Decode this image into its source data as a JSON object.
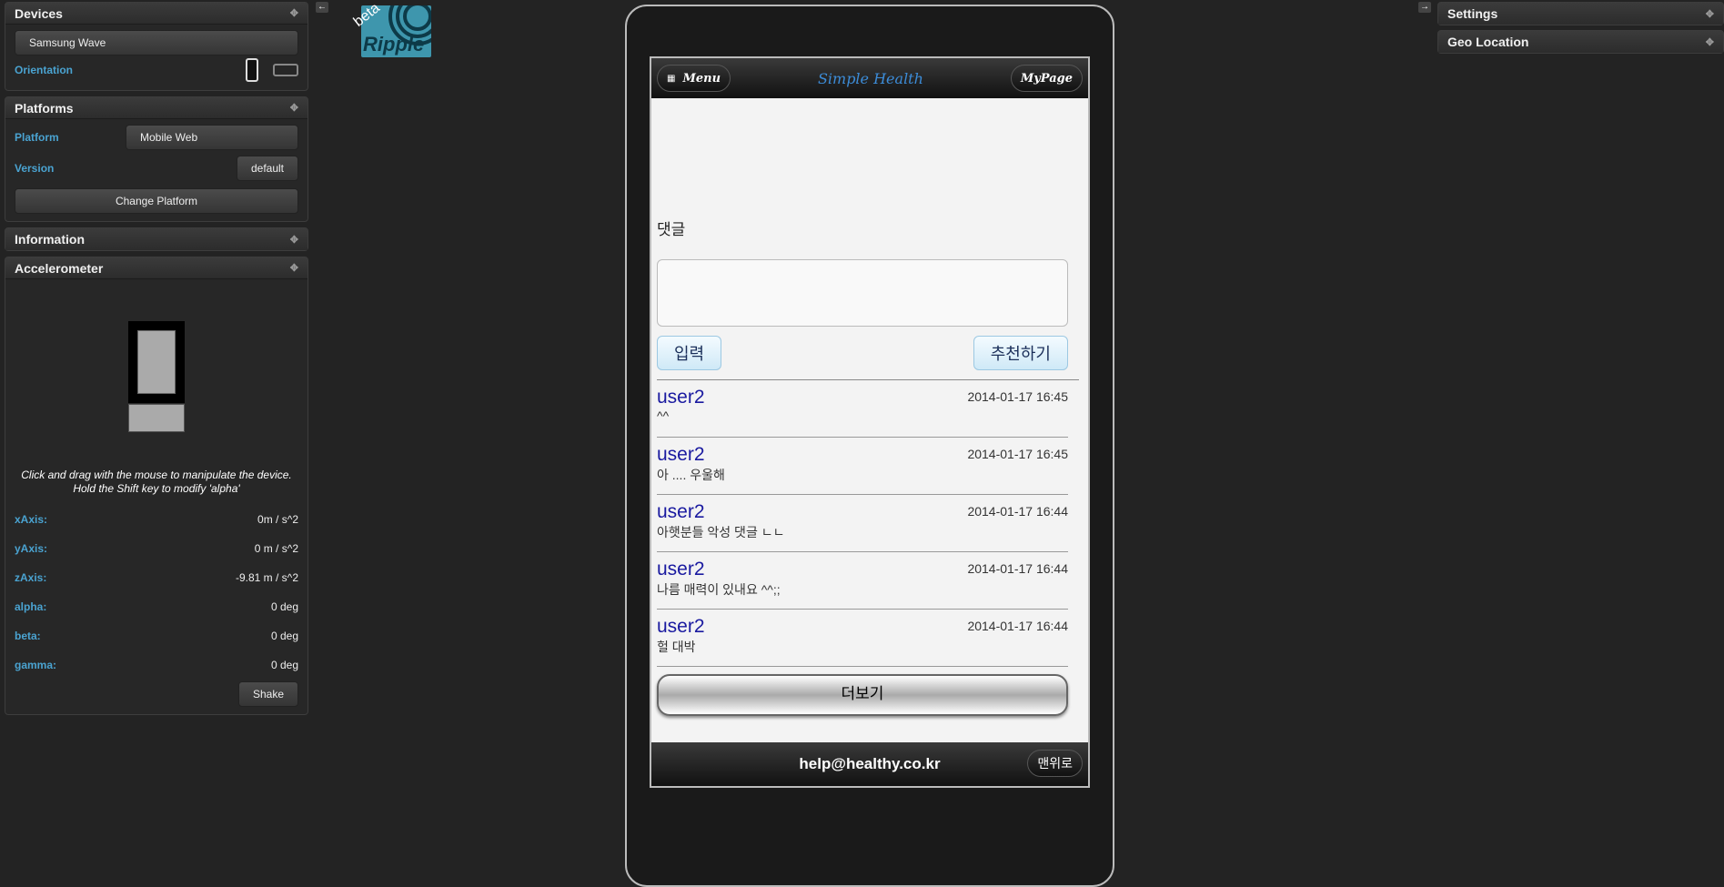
{
  "left": {
    "devices": {
      "title": "Devices",
      "device": "Samsung Wave",
      "orientation_label": "Orientation"
    },
    "platforms": {
      "title": "Platforms",
      "platform_label": "Platform",
      "platform_value": "Mobile Web",
      "version_label": "Version",
      "version_value": "default",
      "change_button": "Change Platform"
    },
    "information": {
      "title": "Information"
    },
    "accelerometer": {
      "title": "Accelerometer",
      "hint_line1": "Click and drag with the mouse to manipulate the device.",
      "hint_line2": "Hold the Shift key to modify 'alpha'",
      "rows": [
        {
          "label": "xAxis:",
          "value": "0m / s^2"
        },
        {
          "label": "yAxis:",
          "value": "0 m / s^2"
        },
        {
          "label": "zAxis:",
          "value": "-9.81 m / s^2"
        },
        {
          "label": "alpha:",
          "value": "0 deg"
        },
        {
          "label": "beta:",
          "value": "0 deg"
        },
        {
          "label": "gamma:",
          "value": "0 deg"
        }
      ],
      "shake_button": "Shake"
    }
  },
  "logo": {
    "text": "Ripple",
    "badge": "beta"
  },
  "app": {
    "menu_button": "Menu",
    "title": "Simple Health",
    "mypage_button": "MyPage",
    "comment_label": "댓글",
    "submit_button": "입력",
    "recommend_button": "추천하기",
    "comments": [
      {
        "user": "user2",
        "text": "^^",
        "date": "2014-01-17 16:45"
      },
      {
        "user": "user2",
        "text": "아 .... 우울해",
        "date": "2014-01-17 16:45"
      },
      {
        "user": "user2",
        "text": "아햇분들 악성 댓글 ㄴㄴ",
        "date": "2014-01-17 16:44"
      },
      {
        "user": "user2",
        "text": "나름 매력이 있내요 ^^;;",
        "date": "2014-01-17 16:44"
      },
      {
        "user": "user2",
        "text": "헐 대박",
        "date": "2014-01-17 16:44"
      }
    ],
    "more_button": "더보기",
    "footer_email": "help@healthy.co.kr",
    "top_button": "맨위로"
  },
  "right": {
    "settings": "Settings",
    "geo": "Geo Location"
  }
}
